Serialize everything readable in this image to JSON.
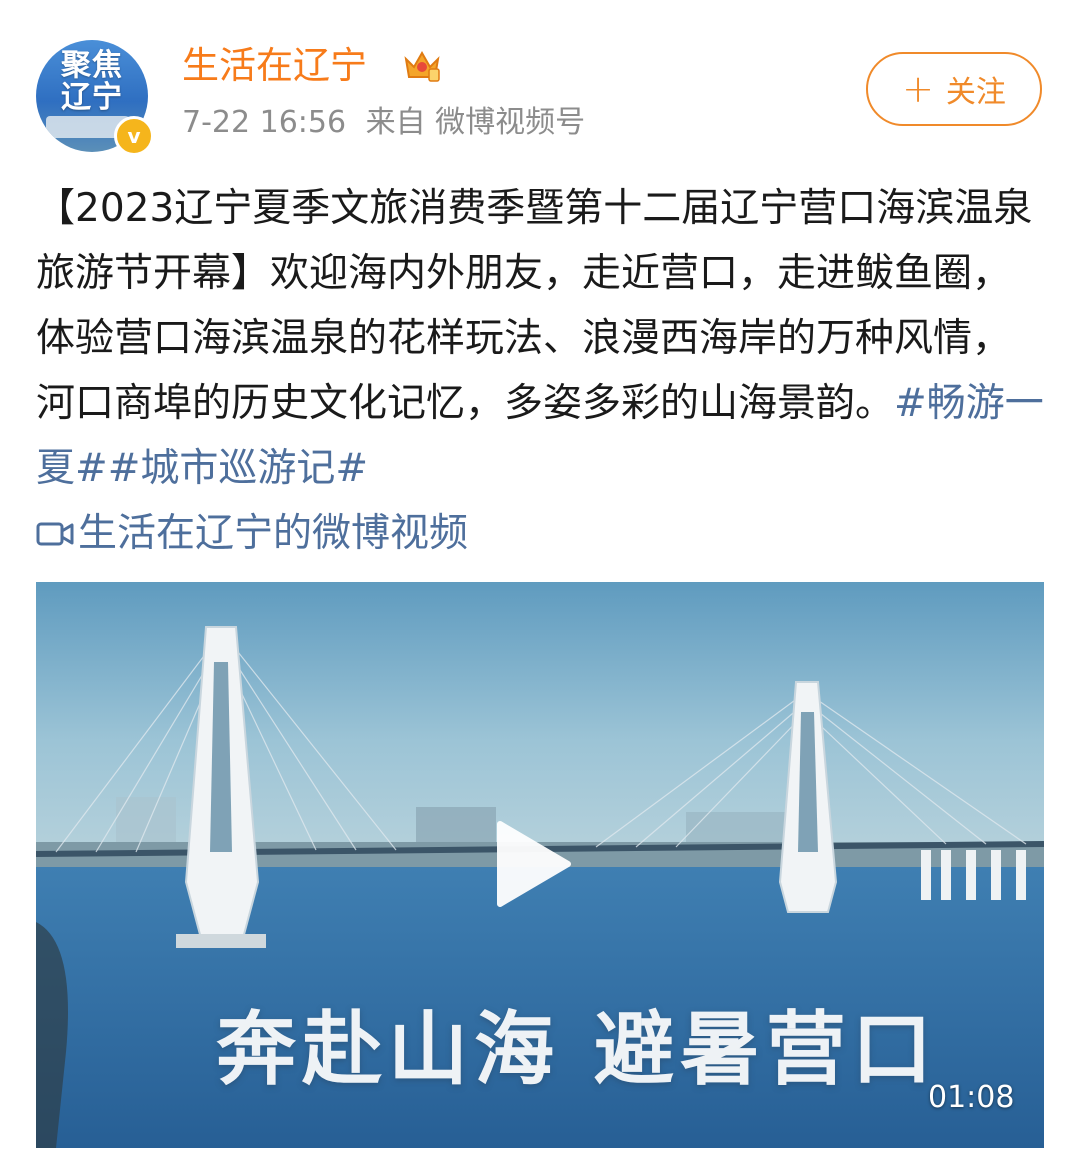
{
  "account": {
    "avatar_text": "聚焦辽宁",
    "name": "生活在辽宁",
    "vip_badge_icon": "crown-badge-icon",
    "verified_icon": "verified-v-icon",
    "verified_mark": "v"
  },
  "post": {
    "date": "7-22 16:56",
    "source": "来自 微博视频号",
    "text_main": "【2023辽宁夏季文旅消费季暨第十二届辽宁营口海滨温泉旅游节开幕】欢迎海内外朋友，走近营口，走进鲅鱼圈，体验营口海滨温泉的花样玩法、浪漫西海岸的万种风情，河口商埠的历史文化记忆，多姿多彩的山海景韵。",
    "hashtag1": "#畅游一夏#",
    "hashtag2": "#城市巡游记#",
    "video_link_text": "生活在辽宁的微博视频",
    "video_link_icon": "video-camera-icon"
  },
  "follow_button": {
    "plus": "+",
    "label": "关注"
  },
  "video": {
    "overlay_title": "奔赴山海  避暑营口",
    "duration": "01:08",
    "play_icon": "play-icon"
  },
  "colors": {
    "username": "#f77b1a",
    "link": "#4e6f9c",
    "follow_border": "#f08a2a",
    "meta": "#8c8c8c"
  }
}
